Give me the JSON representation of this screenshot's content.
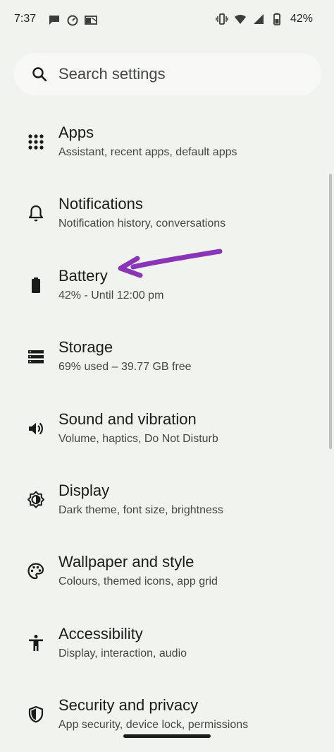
{
  "status_bar": {
    "time": "7:37",
    "battery_percent": "42%",
    "left_icons": [
      "chat-icon",
      "timer-icon",
      "outlook-icon"
    ],
    "right_icons": [
      "vibrate-icon",
      "wifi-icon",
      "signal-icon",
      "battery-icon"
    ]
  },
  "search": {
    "placeholder": "Search settings",
    "icon": "search-icon"
  },
  "settings": [
    {
      "title": "Apps",
      "subtitle": "Assistant, recent apps, default apps",
      "icon": "apps-grid-icon"
    },
    {
      "title": "Notifications",
      "subtitle": "Notification history, conversations",
      "icon": "bell-icon"
    },
    {
      "title": "Battery",
      "subtitle": "42% - Until 12:00 pm",
      "icon": "battery-icon"
    },
    {
      "title": "Storage",
      "subtitle": "69% used – 39.77 GB free",
      "icon": "storage-icon"
    },
    {
      "title": "Sound and vibration",
      "subtitle": "Volume, haptics, Do Not Disturb",
      "icon": "speaker-icon"
    },
    {
      "title": "Display",
      "subtitle": "Dark theme, font size, brightness",
      "icon": "brightness-icon"
    },
    {
      "title": "Wallpaper and style",
      "subtitle": "Colours, themed icons, app grid",
      "icon": "palette-icon"
    },
    {
      "title": "Accessibility",
      "subtitle": "Display, interaction, audio",
      "icon": "accessibility-icon"
    },
    {
      "title": "Security and privacy",
      "subtitle": "App security, device lock, permissions",
      "icon": "shield-icon"
    }
  ],
  "colors": {
    "background": "#f1f4ee",
    "search_background": "#f8f9f6",
    "annotation_arrow": "#8a35b8",
    "text_primary": "#1b1c1a",
    "text_secondary": "#444744"
  }
}
